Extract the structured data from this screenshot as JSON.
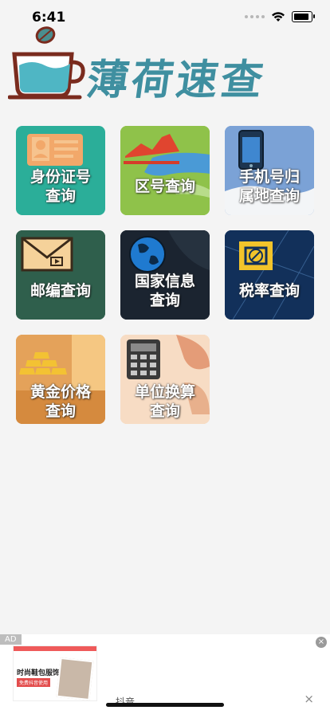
{
  "status_bar": {
    "time": "6:41"
  },
  "app": {
    "title": "薄荷速查"
  },
  "tiles": [
    {
      "label_lines": [
        "身份证号",
        "查询"
      ],
      "icon": "id-card-icon"
    },
    {
      "label_lines": [
        "区号查询"
      ],
      "icon": "map-icon"
    },
    {
      "label_lines": [
        "手机号归",
        "属地查询"
      ],
      "icon": "phone-icon"
    },
    {
      "label_lines": [
        "邮编查询"
      ],
      "icon": "envelope-icon"
    },
    {
      "label_lines": [
        "国家信息",
        "查询"
      ],
      "icon": "globe-icon"
    },
    {
      "label_lines": [
        "税率查询"
      ],
      "icon": "recycle-icon"
    },
    {
      "label_lines": [
        "黄金价格",
        "查询"
      ],
      "icon": "gold-bars-icon"
    },
    {
      "label_lines": [
        "单位换算",
        "查询"
      ],
      "icon": "calculator-icon"
    }
  ],
  "ad": {
    "badge": "AD",
    "close": "×",
    "thumb_title": "时尚鞋包服饰",
    "thumb_sub": "免费抖音使用",
    "app_name": "抖音",
    "dismiss": "×"
  },
  "colors": {
    "title": "#3f8fa0",
    "tile_id": "#2bae99",
    "tile_area": "#8fc24a",
    "tile_phone": "#7ba2d6",
    "tile_post": "#2f5f4c",
    "tile_country": "#1b2430",
    "tile_tax": "#12305a",
    "tile_gold": "#e4a25a",
    "tile_unit": "#f2cdae"
  }
}
